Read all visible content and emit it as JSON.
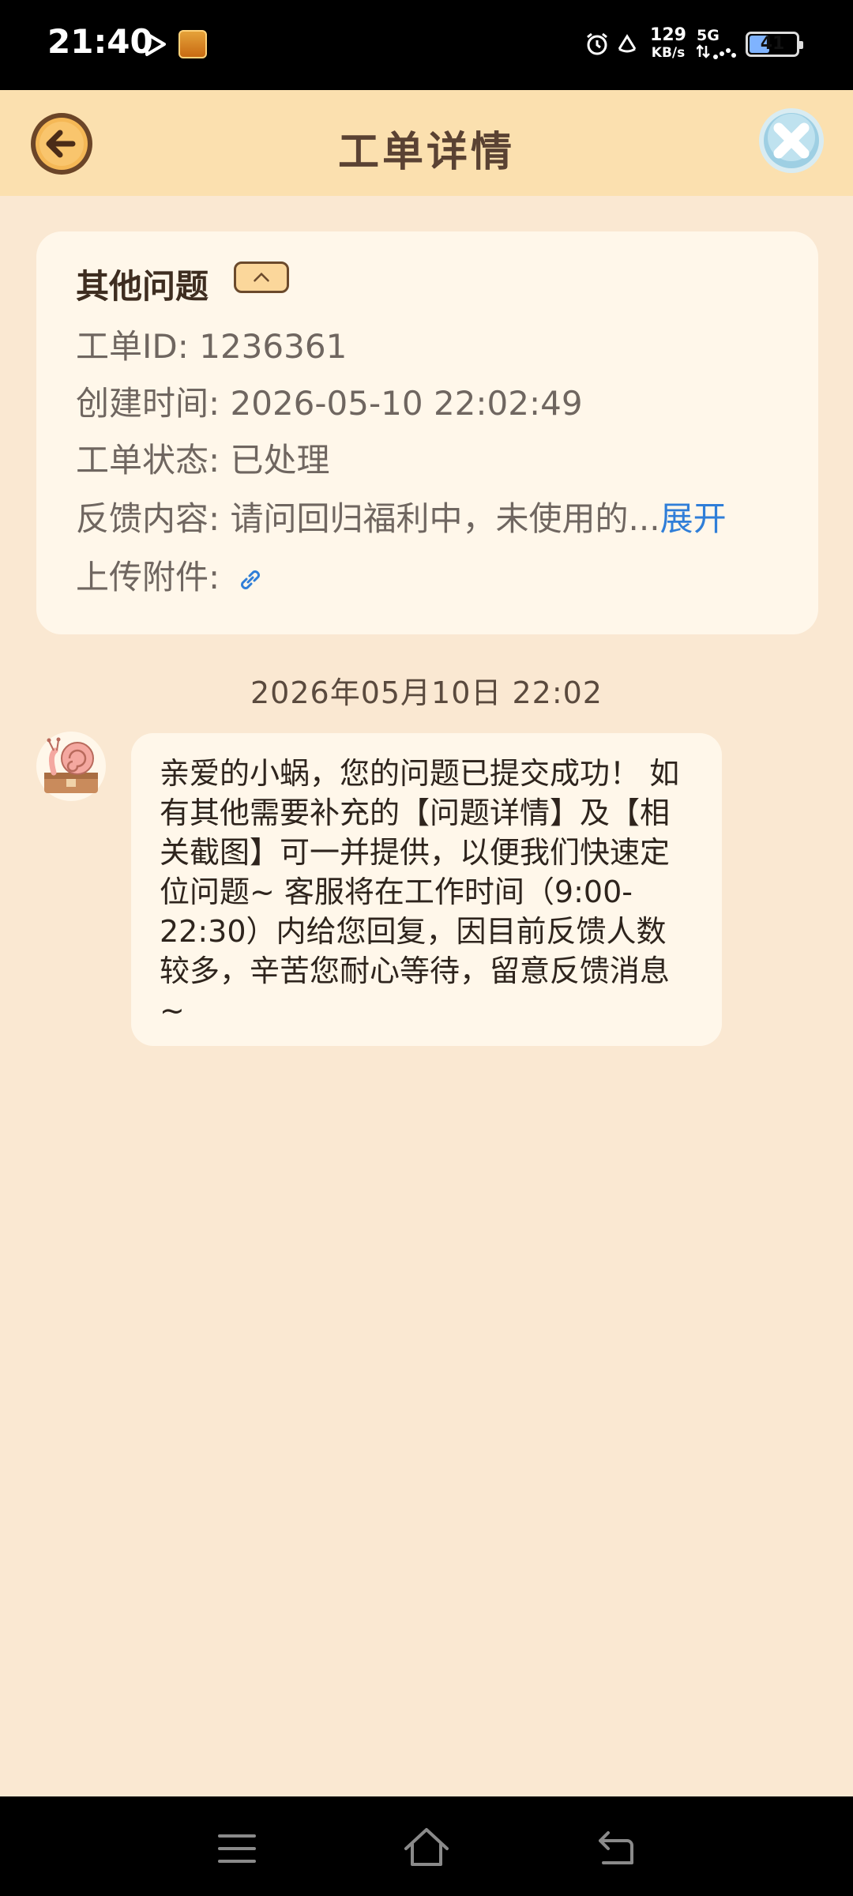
{
  "status_bar": {
    "time": "21:40",
    "net_speed": "129",
    "net_unit": "KB/s",
    "network": "5G",
    "battery": "41",
    "battery_fraction": 0.41,
    "icons": [
      "play-icon",
      "app-icon",
      "alarm-icon",
      "nfc-icon",
      "signal-icon",
      "battery-icon"
    ]
  },
  "header": {
    "title": "工单详情",
    "back_icon": "arrow-left-icon",
    "close_icon": "close-icon"
  },
  "ticket": {
    "category": "其他问题",
    "rows": [
      {
        "label": "工单ID: ",
        "value": "1236361"
      },
      {
        "label": "创建时间: ",
        "value": "2026-05-10 22:02:49"
      },
      {
        "label": "工单状态: ",
        "value": "已处理"
      },
      {
        "label": "反馈内容: ",
        "value": "请问回归福利中，未使用的..."
      },
      {
        "label": "上传附件: ",
        "value": ""
      }
    ],
    "expand_label": "展开"
  },
  "chat": {
    "timestamp": "2026年05月10日 22:02",
    "message": "亲爱的小蜗，您的问题已提交成功！ 如有其他需要补充的【问题详情】及【相关截图】可一并提供，以便我们快速定位问题~ 客服将在工作时间（9:00-22:30）内给您回复，因目前反馈人数较多，辛苦您耐心等待，留意反馈消息~"
  },
  "colors": {
    "background": "#fae8d2",
    "header": "#fbe0af",
    "card": "#fff7ea",
    "link": "#2f7ed8",
    "title_text": "#5a4233"
  }
}
